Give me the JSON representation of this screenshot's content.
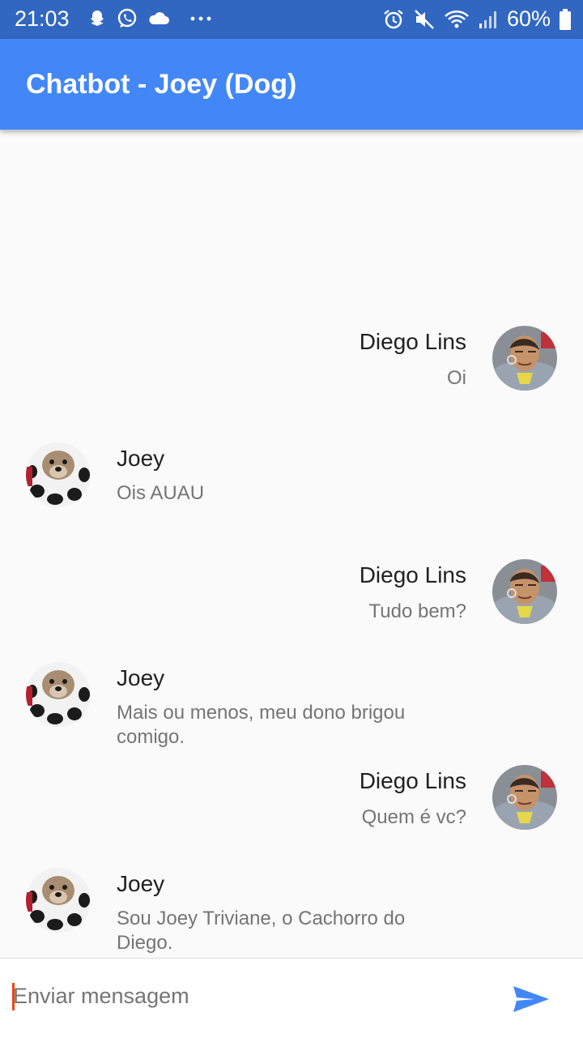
{
  "status_bar": {
    "time": "21:03",
    "battery": "60%",
    "left_icons": [
      "snapchat-icon",
      "whatsapp-icon",
      "cloud-icon",
      "more-icon"
    ],
    "right_icons": [
      "alarm-icon",
      "mute-icon",
      "wifi-icon",
      "signal-icon",
      "battery-icon"
    ]
  },
  "app_bar": {
    "title": "Chatbot - Joey (Dog)",
    "color": "#4287f5"
  },
  "messages": [
    {
      "sender": "Diego Lins",
      "text": "Oi",
      "from": "user"
    },
    {
      "sender": "Joey",
      "text": "Ois AUAU",
      "from": "bot"
    },
    {
      "sender": "Diego Lins",
      "text": "Tudo bem?",
      "from": "user"
    },
    {
      "sender": "Joey",
      "text": "Mais ou menos, meu dono brigou comigo.",
      "from": "bot"
    },
    {
      "sender": "Diego Lins",
      "text": "Quem é vc?",
      "from": "user"
    },
    {
      "sender": "Joey",
      "text": "Sou Joey Triviane, o Cachorro do Diego.",
      "from": "bot"
    }
  ],
  "composer": {
    "placeholder": "Enviar mensagem",
    "value": "",
    "send_icon": "send-icon",
    "accent": "#4287f5"
  }
}
